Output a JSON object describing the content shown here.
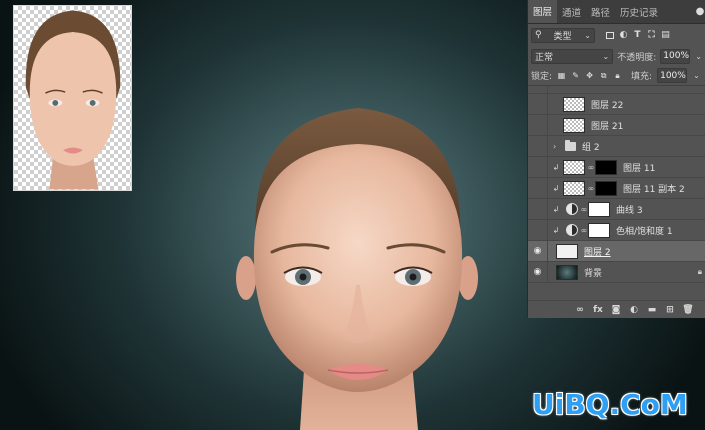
{
  "panel": {
    "tabs": [
      {
        "label": "图层",
        "active": true
      },
      {
        "label": "通道",
        "active": false
      },
      {
        "label": "路径",
        "active": false
      },
      {
        "label": "历史记录",
        "active": false
      }
    ],
    "filter": {
      "label": "类型",
      "icons": [
        "image-filter-icon",
        "adjustment-filter-icon",
        "type-filter-icon",
        "shape-filter-icon",
        "smart-object-filter-icon"
      ]
    },
    "blend_mode": "正常",
    "opacity_label": "不透明度:",
    "opacity_value": "100%",
    "lock_label": "锁定:",
    "fill_label": "填充:",
    "fill_value": "100%",
    "layers": [
      {
        "name": "图层 22",
        "type": "pixel",
        "visible": false
      },
      {
        "name": "图层 21",
        "type": "pixel",
        "visible": false
      },
      {
        "name": "组 2",
        "type": "group",
        "visible": false
      },
      {
        "name": "图层 11",
        "type": "pixel-mask",
        "visible": false,
        "clipped": true
      },
      {
        "name": "图层 11 副本 2",
        "type": "pixel-mask",
        "visible": false,
        "clipped": true
      },
      {
        "name": "曲线 3",
        "type": "adjustment",
        "visible": false,
        "clipped": true
      },
      {
        "name": "色相/饱和度 1",
        "type": "adjustment",
        "visible": false,
        "clipped": true
      },
      {
        "name": "图层 2",
        "type": "pixel",
        "visible": true,
        "selected": true
      },
      {
        "name": "背景",
        "type": "background",
        "visible": true,
        "locked": true
      }
    ],
    "footer_icons": [
      "link-layers-icon",
      "fx-icon",
      "add-mask-icon",
      "new-adjustment-icon",
      "new-group-icon",
      "new-layer-icon",
      "delete-layer-icon"
    ]
  },
  "colors": {
    "panel_bg": "#535353",
    "tab_bar_bg": "#3d3d3d",
    "watermark": "#2e9ff3"
  },
  "watermark": {
    "text": "UiBQ.CoM"
  }
}
